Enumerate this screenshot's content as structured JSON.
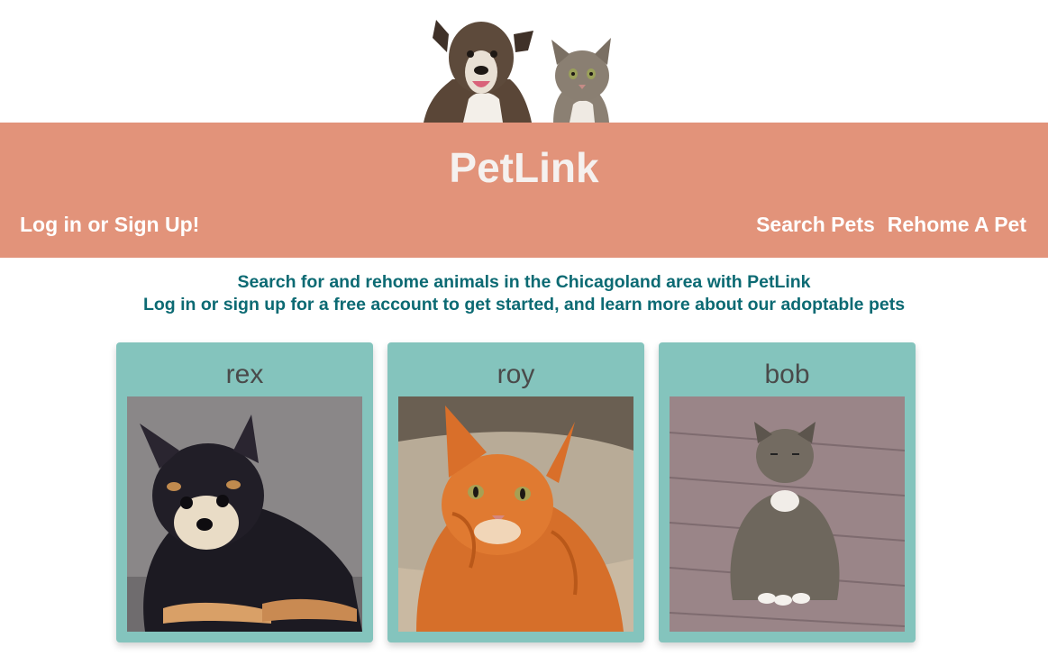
{
  "header": {
    "hero_image": "dog-and-cat-peeking-image",
    "site_title": "PetLink",
    "nav_login": "Log in or Sign Up!",
    "nav_search": "Search Pets",
    "nav_rehome": "Rehome A Pet",
    "banner_color": "#e2937a"
  },
  "intro": {
    "line1": "Search for and rehome animals in the Chicagoland area with PetLink",
    "line2": "Log in or sign up for a free account to get started, and learn more about our adoptable pets",
    "text_color": "#0c6a73"
  },
  "pets": [
    {
      "name": "rex",
      "photo": "black-and-tan-pomeranian-photo"
    },
    {
      "name": "roy",
      "photo": "orange-tabby-cat-photo"
    },
    {
      "name": "bob",
      "photo": "grey-tabby-cat-on-bricks-photo"
    }
  ],
  "card_color": "#84c4bd"
}
